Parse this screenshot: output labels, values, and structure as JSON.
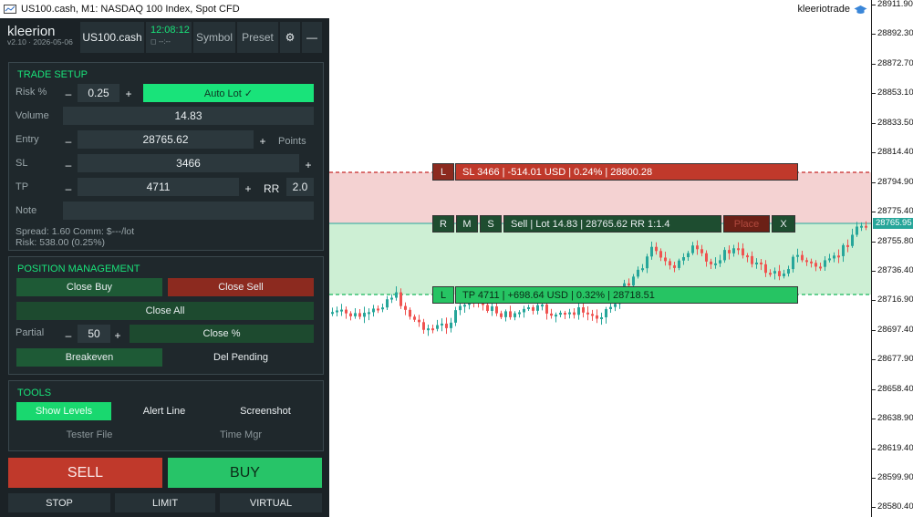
{
  "chart": {
    "title": "US100.cash, M1:  NASDAQ 100 Index, Spot CFD",
    "brand": "kleeriotrade",
    "price_labels": [
      "28911.90",
      "28892.30",
      "28872.70",
      "28853.10",
      "28833.50",
      "28814.40",
      "28794.90",
      "28775.40",
      "28755.80",
      "28736.40",
      "28716.90",
      "28697.40",
      "28677.90",
      "28658.40",
      "28638.90",
      "28619.40",
      "28599.90",
      "28580.40"
    ],
    "current_price": "28765.95",
    "sl_line": {
      "btn": "L",
      "text": "SL 3466 | -514.01 USD | 0.24% | 28800.28"
    },
    "entry_line": {
      "r": "R",
      "m": "M",
      "s": "S",
      "text": "Sell | Lot 14.83 | 28765.62  RR 1:1.4",
      "place": "Place",
      "close": "X"
    },
    "tp_line": {
      "btn": "L",
      "text": "TP 4711 | +698.64 USD | 0.32% | 28718.51"
    },
    "colors": {
      "sl_zone": "#f4d2d2",
      "tp_zone": "#cdefd4",
      "up": "#26a69a",
      "down": "#ef5350"
    }
  },
  "panel": {
    "app_name": "kleerion",
    "version": "v2.10 · 2026-05-06",
    "symbol": "US100.cash",
    "time": "12:08:12",
    "time_sub": "--:--",
    "symbol_btn": "Symbol",
    "preset_btn": "Preset",
    "gear_icon": "⚙",
    "minimize_icon": "—",
    "trade_setup": {
      "title": "TRADE SETUP",
      "risk_label": "Risk %",
      "risk_value": "0.25",
      "auto_lot": "Auto Lot ✓",
      "volume_label": "Volume",
      "volume_value": "14.83",
      "entry_label": "Entry",
      "entry_value": "28765.62",
      "points_label": "Points",
      "sl_label": "SL",
      "sl_value": "3466",
      "tp_label": "TP",
      "tp_value": "4711",
      "rr_label": "RR",
      "rr_value": "2.0",
      "note_label": "Note",
      "note_value": "",
      "spread_text": "Spread: 1.60   Comm: $---/lot",
      "risk_text": "Risk: 538.00 (0.25%)",
      "minus": "–",
      "plus": "+"
    },
    "position_management": {
      "title": "POSITION MANAGEMENT",
      "close_buy": "Close Buy",
      "close_sell": "Close Sell",
      "close_all": "Close All",
      "partial_label": "Partial",
      "partial_value": "50",
      "close_pct": "Close %",
      "breakeven": "Breakeven",
      "del_pending": "Del Pending"
    },
    "tools": {
      "title": "TOOLS",
      "show_levels": "Show Levels",
      "alert_line": "Alert Line",
      "screenshot": "Screenshot",
      "tester_file": "Tester File",
      "time_mgr": "Time Mgr"
    },
    "sell": "SELL",
    "buy": "BUY",
    "stop": "STOP",
    "limit": "LIMIT",
    "virtual": "VIRTUAL"
  }
}
